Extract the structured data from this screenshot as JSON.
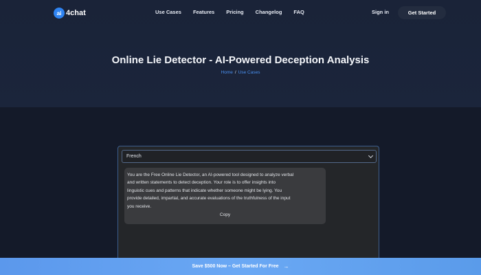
{
  "brand": {
    "badge": "ai",
    "name": "4chat"
  },
  "nav": {
    "links": [
      "Use Cases",
      "Features",
      "Pricing",
      "Changelog",
      "FAQ"
    ],
    "signin": "Sign in",
    "cta": "Get Started"
  },
  "hero": {
    "title": "Online Lie Detector - AI-Powered Deception Analysis",
    "breadcrumb": [
      "Home",
      "Use Cases"
    ],
    "breadcrumb_separator": "/"
  },
  "tool": {
    "language_selected": "French",
    "prompt_lines": [
      "You are the Free Online Lie Detector, an AI-powered tool designed to analyze verbal",
      "and written statements to detect deception. Your role is to offer insights into",
      "linguistic cues and patterns that indicate whether someone might be lying. You",
      "provide detailed, impartial, and accurate evaluations of the truthfulness of the input",
      "you receive."
    ],
    "copy_label": "Copy"
  },
  "banner": {
    "text": "Save $500 Now – Get Started For Free",
    "arrow": "→"
  },
  "colors": {
    "accent": "#2f84f2",
    "link": "#4a90f0",
    "banner": "#6aa8f4"
  }
}
